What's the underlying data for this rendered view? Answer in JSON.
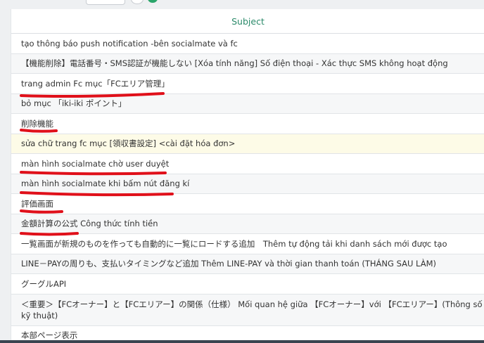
{
  "table": {
    "header": "Subject",
    "rows": [
      "tạo thông báo push notification -bên socialmate và fc",
      "【機能削除】電話番号・SMS認証が機能しない [Xóa tính năng] Số điện thoại - Xác thực SMS không hoạt động",
      "trang admin Fc mục「FCエリア管理」",
      "bỏ mục 「iki-iki ポイント」",
      "削除機能",
      "sửa chữ trang fc mục [領収書設定] <cài đặt hóa đơn>",
      "màn hình socialmate chờ user duyệt",
      "màn hình socialmate khi bấm nút đăng kí",
      "評価画面",
      "金額計算の公式 Công thức tính tiền",
      "一覧画面が新規のものを作っても自動的に一覧にロードする追加　Thêm tự động tải khi danh sách mới được tạo",
      "LINE－PAYの周りも、支払いタイミングなど追加 Thêm LINE-PAY và thời gian thanh toán (THÁNG SAU LÀM)",
      "グーグルAPI",
      "＜重要＞【FCオーナー】と【FCエリアー】の関係（仕様） Mối quan hệ giữa 【FCオーナー】với 【FCエリアー】(Thông số kỹ thuật)",
      "本部ページ表示"
    ]
  },
  "colors": {
    "header_text": "#2b8a6a",
    "highlight_row": "#fdfbe7",
    "annotation_red": "#e0101a"
  }
}
